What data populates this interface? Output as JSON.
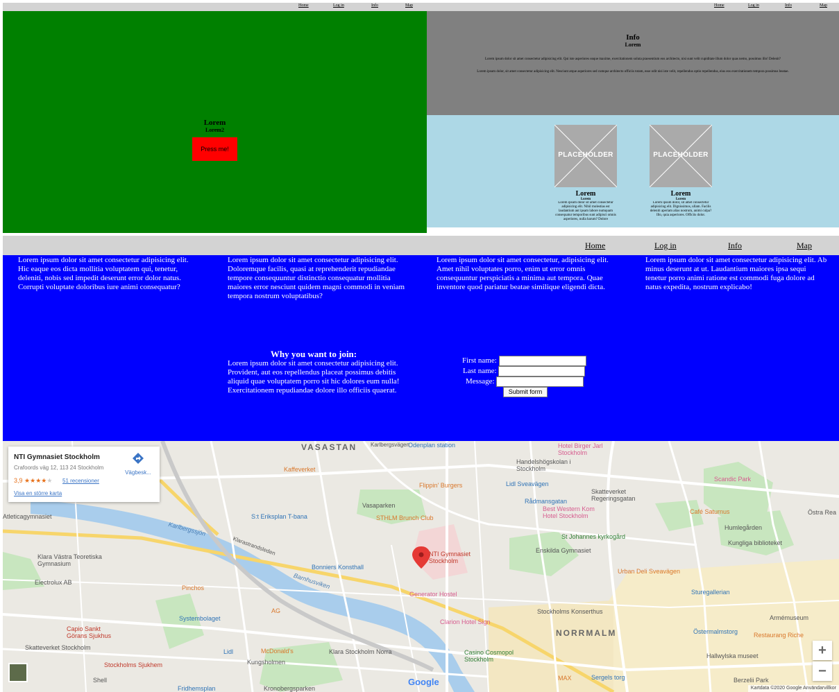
{
  "nav": {
    "home": "Home",
    "login": "Log in",
    "info": "Info",
    "map": "Map"
  },
  "hero": {
    "title": "Lorem",
    "subtitle": "Lorem2",
    "button": "Press me!"
  },
  "info": {
    "title": "Info",
    "subtitle": "Lorem",
    "p1": "Lorem ipsum dolor sit amet consectetur adipisicing elit. Qui iste asperiores eaque maxime, exercitationem soluta praesentium eos architecto, nisi sunt velit cupiditate illum dolor quas nemo, possimus illo! Delenit?",
    "p2": "Lorem ipsum dolor, sit amet consectetur adipisicing elit. Nesciunt atque asperiores sed cumque architecto officiis totam, esse odit nisi iste velit, repellendus optio repellendus, eius eos exercitationem tempora possimus beatae."
  },
  "cards": [
    {
      "placeholder": "PLACEHOLDER",
      "title": "Lorem",
      "subtitle": "Lorem",
      "text": "Lorem ipsum dolor sit amet consectetur adipisicing elit. Nihil molestias est laudantium aut ipsam labore numquam consequatur temporibus sunt adipisci omnis asperiores, nulla harum? Dolore"
    },
    {
      "placeholder": "PLACEHOLDER",
      "title": "Lorem",
      "subtitle": "Lorem",
      "text": "Lorem ipsum dolor, sit amet consectetur adipisicing elit. Dignissimos, ullam. Facilis deleniti aperiam alias nostrum, animi culpa? Illo, quia asperiores. Officiis dolor."
    }
  ],
  "columns": [
    "Lorem ipsum dolor sit amet consectetur adipisicing elit. Hic eaque eos dicta mollitia voluptatem qui, tenetur, deleniti, nobis sed impedit deserunt error dolor natus. Corrupti voluptate doloribus iure animi consequatur?",
    "Lorem ipsum dolor sit amet consectetur adipisicing elit. Doloremque facilis, quasi at reprehenderit repudiandae tempore consequuntur distinctio consequatur mollitia maiores error nesciunt quidem magni commodi in veniam tempora nostrum voluptatibus?",
    "Lorem ipsum dolor sit amet consectetur, adipisicing elit. Amet nihil voluptates porro, enim ut error omnis consequuntur perspiciatis a minima aut tempora. Quae inventore quod pariatur beatae similique eligendi dicta.",
    "Lorem ipsum dolor sit amet consectetur adipisicing elit. Ab minus deserunt at ut. Laudantium maiores ipsa sequi tenetur porro animi ratione est commodi fuga dolore ad natus expedita, nostrum explicabo!"
  ],
  "join": {
    "title": "Why you want to join:",
    "text": "Lorem ipsum dolor sit amet consectetur adipisicing elit. Provident, aut eos repellendus placeat possimus debitis aliquid quae voluptatem porro sit hic dolores eum nulla! Exercitationem repudiandae dolore illo officiis quaerat."
  },
  "form": {
    "first_name": "First name:",
    "last_name": "Last name:",
    "message": "Message:",
    "submit": "Submit form"
  },
  "map": {
    "place_name": "NTI Gymnasiet Stockholm",
    "address": "Crafoords väg 12, 113 24 Stockholm",
    "rating": "3,9",
    "stars": "★★★★★",
    "rating_value": 3.9,
    "reviews": "51 recensioner",
    "larger_map": "Visa en större karta",
    "directions": "Vägbesk...",
    "zoom_in": "+",
    "zoom_out": "−",
    "google": "Google",
    "attribution": "Kartdata ©2020 Google    Användarvillkor",
    "labels": [
      {
        "text": "VASASTAN",
        "cls": "dist"
      },
      {
        "text": "NORRMALM",
        "cls": "dist"
      },
      {
        "text": "Odenplan station",
        "cls": "poi-b"
      },
      {
        "text": "Karlbergsvägen",
        "cls": "road"
      },
      {
        "text": "Hotel Birger Jarl Stockholm",
        "cls": "poi-p"
      },
      {
        "text": "Handelshögskolan i Stockholm",
        "cls": ""
      },
      {
        "text": "Kaffeverket",
        "cls": "poi-o"
      },
      {
        "text": "Flippin' Burgers",
        "cls": "poi-o"
      },
      {
        "text": "Lidl Sveavägen",
        "cls": "poi-b"
      },
      {
        "text": "Skatteverket Regeringsgatan",
        "cls": ""
      },
      {
        "text": "Rådmansgatan",
        "cls": "poi-b"
      },
      {
        "text": "Best Western Kom Hotel Stockholm",
        "cls": "poi-p"
      },
      {
        "text": "Scandic Park",
        "cls": "poi-p"
      },
      {
        "text": "Café Saturnus",
        "cls": "poi-o"
      },
      {
        "text": "Humlegården",
        "cls": ""
      },
      {
        "text": "Kungliga biblioteket",
        "cls": ""
      },
      {
        "text": "Östra Rea",
        "cls": ""
      },
      {
        "text": "Atleticagymnasiet",
        "cls": ""
      },
      {
        "text": "S:t Eriksplan T-bana",
        "cls": "poi-b"
      },
      {
        "text": "Vasaparken",
        "cls": ""
      },
      {
        "text": "STHLM Brunch Club",
        "cls": "poi-o"
      },
      {
        "text": "St Johannes kyrkogård",
        "cls": "poi-g"
      },
      {
        "text": "Enskilda Gymnasiet",
        "cls": ""
      },
      {
        "text": "Karlbergssjön",
        "cls": "water"
      },
      {
        "text": "Klarastrandsleden",
        "cls": "road"
      },
      {
        "text": "Klara Västra Teoretiska Gymnasium",
        "cls": ""
      },
      {
        "text": "NTI Gymnasiet Stockholm",
        "cls": "poi-r"
      },
      {
        "text": "Bonniers Konsthall",
        "cls": "poi-b"
      },
      {
        "text": "Urban Deli Sveavägen",
        "cls": "poi-o"
      },
      {
        "text": "Electrolux AB",
        "cls": ""
      },
      {
        "text": "Barnhusviken",
        "cls": "water"
      },
      {
        "text": "Pinchos",
        "cls": "poi-o"
      },
      {
        "text": "Generator Hostel",
        "cls": "poi-p"
      },
      {
        "text": "Sturegallerian",
        "cls": "poi-b"
      },
      {
        "text": "AG",
        "cls": "poi-o"
      },
      {
        "text": "Systembolaget",
        "cls": "poi-b"
      },
      {
        "text": "Clarion Hotel Sign",
        "cls": "poi-p"
      },
      {
        "text": "Stockholms Konserthus",
        "cls": ""
      },
      {
        "text": "Armémuseum",
        "cls": ""
      },
      {
        "text": "Östermalmstorg",
        "cls": "poi-b"
      },
      {
        "text": "Capio Sankt Görans Sjukhus",
        "cls": "poi-r"
      },
      {
        "text": "Restaurang Riche",
        "cls": "poi-o"
      },
      {
        "text": "Skatteverket Stockholm",
        "cls": ""
      },
      {
        "text": "Lidl",
        "cls": "poi-b"
      },
      {
        "text": "McDonald's",
        "cls": "poi-o"
      },
      {
        "text": "Klara Stockholm Norra",
        "cls": ""
      },
      {
        "text": "Casino Cosmopol Stockholm",
        "cls": "poi-g"
      },
      {
        "text": "Hallwylska museet",
        "cls": ""
      },
      {
        "text": "Stockholms Sjukhem",
        "cls": "poi-r"
      },
      {
        "text": "Kungsholmen",
        "cls": ""
      },
      {
        "text": "Shell",
        "cls": ""
      },
      {
        "text": "MAX",
        "cls": "poi-o"
      },
      {
        "text": "Sergels torg",
        "cls": "poi-b"
      },
      {
        "text": "Berzelii Park",
        "cls": ""
      },
      {
        "text": "Fridhemsplan",
        "cls": "poi-b"
      },
      {
        "text": "Kronobergsparken",
        "cls": ""
      }
    ]
  },
  "colors": {
    "green": "#008000",
    "gray": "#808080",
    "lightblue": "#add8e6",
    "blue": "#0000ff",
    "red": "#ff0000",
    "nav": "#d3d3d3"
  }
}
